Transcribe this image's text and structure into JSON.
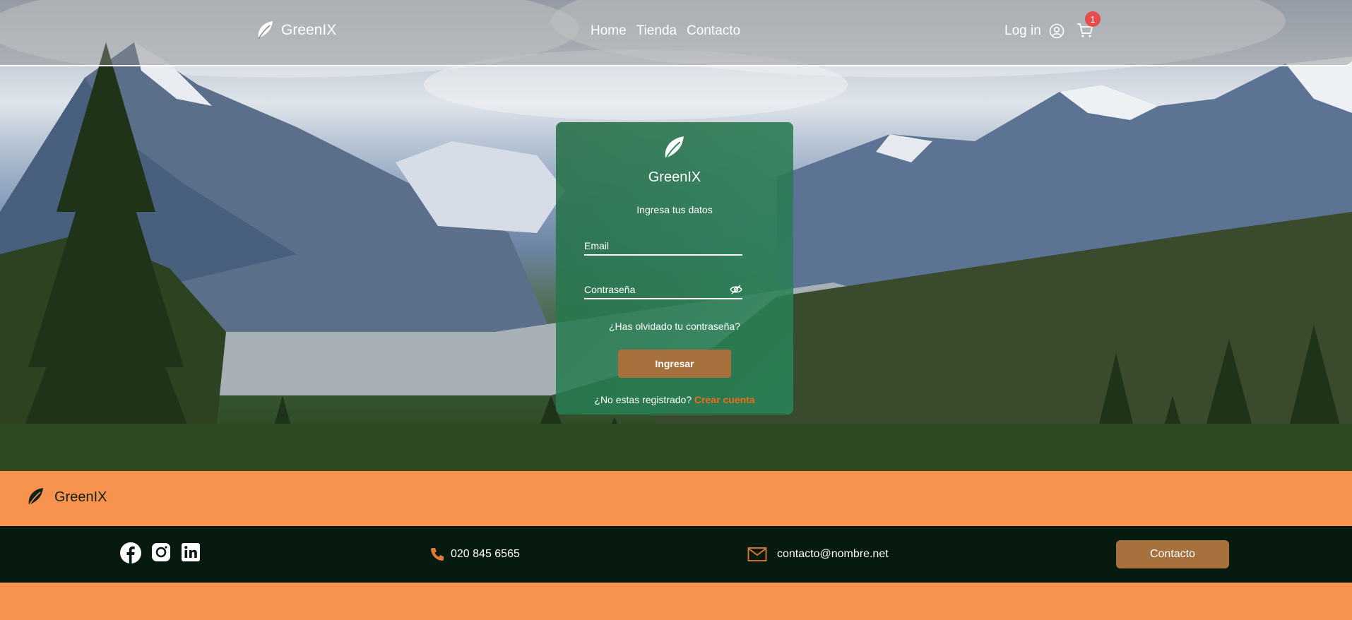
{
  "header": {
    "brand": "GreenIX",
    "nav": [
      "Home",
      "Tienda",
      "Contacto"
    ],
    "login_label": "Log in",
    "cart_count": "1"
  },
  "login": {
    "brand": "GreenIX",
    "subtitle": "Ingresa tus datos",
    "email_placeholder": "Email",
    "password_placeholder": "Contraseña",
    "forgot_label": "¿Has olvidado tu contraseña?",
    "submit_label": "Ingresar",
    "register_text": "¿No estas registrado?",
    "register_link": "Crear cuenta"
  },
  "footer": {
    "brand": "GreenIX",
    "phone": "020 845 6565",
    "email": "contacto@nombre.net",
    "contact_button": "Contacto"
  },
  "colors": {
    "accent": "#f8934f",
    "button": "#a7713e",
    "card": "#2f8a5c",
    "footer_dark": "#071a10",
    "link": "#f06a1d"
  }
}
